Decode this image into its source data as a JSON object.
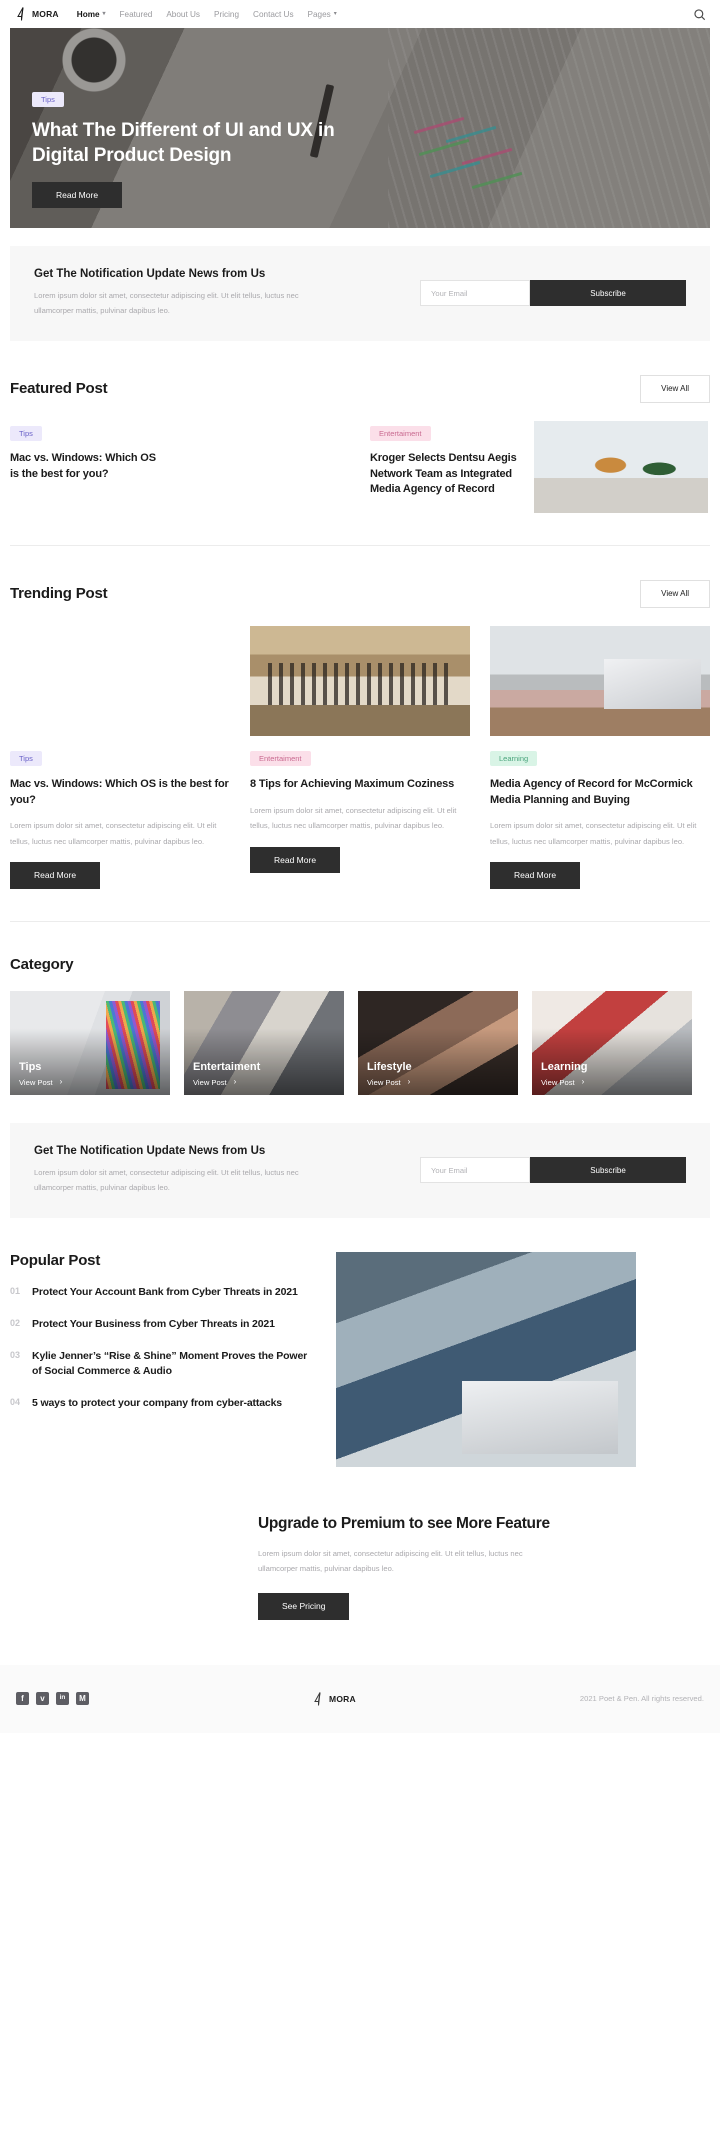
{
  "brand": {
    "name": "MORA",
    "mark": "mora-logo-icon"
  },
  "nav": {
    "items": [
      {
        "label": "Home",
        "caret": "▾",
        "active": true
      },
      {
        "label": "Featured",
        "caret": "",
        "active": false
      },
      {
        "label": "About Us",
        "caret": "",
        "active": false
      },
      {
        "label": "Pricing",
        "caret": "",
        "active": false
      },
      {
        "label": "Contact Us",
        "caret": "",
        "active": false
      },
      {
        "label": "Pages",
        "caret": "▾",
        "active": false
      }
    ],
    "search_icon": "search-icon"
  },
  "hero": {
    "badge": "Tips",
    "title": "What The Different of UI and UX in Digital Product Design",
    "button": "Read More"
  },
  "newsletter_top": {
    "title": "Get The Notification Update News from Us",
    "desc": "Lorem ipsum dolor sit amet, consectetur adipiscing elit. Ut elit tellus, luctus nec ullamcorper mattis, pulvinar dapibus leo.",
    "placeholder": "Your Email",
    "value": "",
    "button": "Subscribe"
  },
  "featured": {
    "title": "Featured Post",
    "view_all": "View All",
    "posts": [
      {
        "badge": "Tips",
        "badge_kind": "tips",
        "title": "Mac vs. Windows: Which OS is the best for you?",
        "image": "shop-customer-photo"
      },
      {
        "badge": "Entertaiment",
        "badge_kind": "ent",
        "title": "Kroger Selects Dentsu Aegis Network Team as Integrated Media Agency of Record",
        "image": "man-playing-guitar-photo"
      }
    ]
  },
  "trending": {
    "title": "Trending Post",
    "view_all": "View All",
    "posts": [
      {
        "badge": "Tips",
        "badge_kind": "tips",
        "title": "Mac vs. Windows: Which OS is the best for you?",
        "desc": "Lorem ipsum dolor sit amet, consectetur adipiscing elit. Ut elit tellus, luctus nec ullamcorper mattis, pulvinar dapibus leo.",
        "button": "Read More",
        "image": "shop-customer-photo"
      },
      {
        "badge": "Entertaiment",
        "badge_kind": "ent",
        "title": "8 Tips for Achieving Maximum Coziness",
        "desc": "Lorem ipsum dolor sit amet, consectetur adipiscing elit. Ut elit tellus, luctus nec ullamcorper mattis, pulvinar dapibus leo.",
        "button": "Read More",
        "image": "old-man-chess-photo"
      },
      {
        "badge": "Learning",
        "badge_kind": "learn",
        "title": "Media Agency of Record for McCormick Media Planning and Buying",
        "desc": "Lorem ipsum dolor sit amet, consectetur adipiscing elit. Ut elit tellus, luctus nec ullamcorper mattis, pulvinar dapibus leo.",
        "button": "Read More",
        "image": "woman-laptop-photo"
      }
    ]
  },
  "category": {
    "title": "Category",
    "items": [
      {
        "name": "Tips",
        "link": "View Post",
        "chevron": "›",
        "image": "pencils-notebook-photo"
      },
      {
        "name": "Entertaiment",
        "link": "View Post",
        "chevron": "›",
        "image": "office-meeting-photo"
      },
      {
        "name": "Lifestyle",
        "link": "View Post",
        "chevron": "›",
        "image": "friends-laughing-photo"
      },
      {
        "name": "Learning",
        "link": "View Post",
        "chevron": "›",
        "image": "woman-learning-photo"
      }
    ]
  },
  "newsletter_bottom": {
    "title": "Get The Notification Update News from Us",
    "desc": "Lorem ipsum dolor sit amet, consectetur adipiscing elit. Ut elit tellus, luctus nec ullamcorper mattis, pulvinar dapibus leo.",
    "placeholder": "Your Email",
    "value": "",
    "button": "Subscribe"
  },
  "popular": {
    "title": "Popular Post",
    "image": "man-reading-laptop-photo",
    "items": [
      {
        "num": "01",
        "title": "Protect Your Account Bank from Cyber Threats in 2021"
      },
      {
        "num": "02",
        "title": "Protect Your Business from Cyber Threats in 2021"
      },
      {
        "num": "03",
        "title": "Kylie Jenner’s “Rise & Shine” Moment Proves the Power of Social Commerce & Audio"
      },
      {
        "num": "04",
        "title": "5 ways to protect your company from cyber-attacks"
      }
    ]
  },
  "premium": {
    "title": "Upgrade to Premium to see More Feature",
    "desc": "Lorem ipsum dolor sit amet, consectetur adipiscing elit. Ut elit tellus, luctus nec ullamcorper mattis, pulvinar dapibus leo.",
    "button": "See Pricing",
    "image": "shop-customer-photo"
  },
  "footer": {
    "socials": [
      {
        "name": "facebook-icon",
        "glyph": "f"
      },
      {
        "name": "twitter-icon",
        "glyph": "ᴠ"
      },
      {
        "name": "linkedin-icon",
        "glyph": "in"
      },
      {
        "name": "medium-icon",
        "glyph": "M"
      }
    ],
    "brand": "MORA",
    "copyright": "2021 Poet & Pen. All rights reserved."
  },
  "colors": {
    "dark": "#2e2e2e",
    "badge_tips_bg": "#ece9fb",
    "badge_tips_fg": "#6a62c8",
    "badge_ent_bg": "#fbdfe9",
    "badge_ent_fg": "#c96a90",
    "badge_learn_bg": "#d9f4e6",
    "badge_learn_fg": "#4aa47c",
    "muted": "#aaa9ad",
    "panel": "#f7f7f7"
  }
}
